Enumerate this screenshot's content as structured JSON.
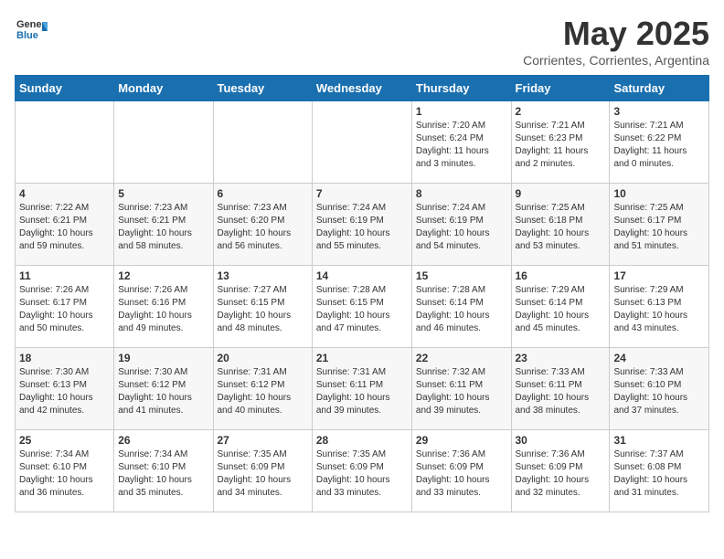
{
  "logo": {
    "general": "General",
    "blue": "Blue"
  },
  "title": "May 2025",
  "subtitle": "Corrientes, Corrientes, Argentina",
  "headers": [
    "Sunday",
    "Monday",
    "Tuesday",
    "Wednesday",
    "Thursday",
    "Friday",
    "Saturday"
  ],
  "weeks": [
    [
      {
        "day": "",
        "info": ""
      },
      {
        "day": "",
        "info": ""
      },
      {
        "day": "",
        "info": ""
      },
      {
        "day": "",
        "info": ""
      },
      {
        "day": "1",
        "info": "Sunrise: 7:20 AM\nSunset: 6:24 PM\nDaylight: 11 hours\nand 3 minutes."
      },
      {
        "day": "2",
        "info": "Sunrise: 7:21 AM\nSunset: 6:23 PM\nDaylight: 11 hours\nand 2 minutes."
      },
      {
        "day": "3",
        "info": "Sunrise: 7:21 AM\nSunset: 6:22 PM\nDaylight: 11 hours\nand 0 minutes."
      }
    ],
    [
      {
        "day": "4",
        "info": "Sunrise: 7:22 AM\nSunset: 6:21 PM\nDaylight: 10 hours\nand 59 minutes."
      },
      {
        "day": "5",
        "info": "Sunrise: 7:23 AM\nSunset: 6:21 PM\nDaylight: 10 hours\nand 58 minutes."
      },
      {
        "day": "6",
        "info": "Sunrise: 7:23 AM\nSunset: 6:20 PM\nDaylight: 10 hours\nand 56 minutes."
      },
      {
        "day": "7",
        "info": "Sunrise: 7:24 AM\nSunset: 6:19 PM\nDaylight: 10 hours\nand 55 minutes."
      },
      {
        "day": "8",
        "info": "Sunrise: 7:24 AM\nSunset: 6:19 PM\nDaylight: 10 hours\nand 54 minutes."
      },
      {
        "day": "9",
        "info": "Sunrise: 7:25 AM\nSunset: 6:18 PM\nDaylight: 10 hours\nand 53 minutes."
      },
      {
        "day": "10",
        "info": "Sunrise: 7:25 AM\nSunset: 6:17 PM\nDaylight: 10 hours\nand 51 minutes."
      }
    ],
    [
      {
        "day": "11",
        "info": "Sunrise: 7:26 AM\nSunset: 6:17 PM\nDaylight: 10 hours\nand 50 minutes."
      },
      {
        "day": "12",
        "info": "Sunrise: 7:26 AM\nSunset: 6:16 PM\nDaylight: 10 hours\nand 49 minutes."
      },
      {
        "day": "13",
        "info": "Sunrise: 7:27 AM\nSunset: 6:15 PM\nDaylight: 10 hours\nand 48 minutes."
      },
      {
        "day": "14",
        "info": "Sunrise: 7:28 AM\nSunset: 6:15 PM\nDaylight: 10 hours\nand 47 minutes."
      },
      {
        "day": "15",
        "info": "Sunrise: 7:28 AM\nSunset: 6:14 PM\nDaylight: 10 hours\nand 46 minutes."
      },
      {
        "day": "16",
        "info": "Sunrise: 7:29 AM\nSunset: 6:14 PM\nDaylight: 10 hours\nand 45 minutes."
      },
      {
        "day": "17",
        "info": "Sunrise: 7:29 AM\nSunset: 6:13 PM\nDaylight: 10 hours\nand 43 minutes."
      }
    ],
    [
      {
        "day": "18",
        "info": "Sunrise: 7:30 AM\nSunset: 6:13 PM\nDaylight: 10 hours\nand 42 minutes."
      },
      {
        "day": "19",
        "info": "Sunrise: 7:30 AM\nSunset: 6:12 PM\nDaylight: 10 hours\nand 41 minutes."
      },
      {
        "day": "20",
        "info": "Sunrise: 7:31 AM\nSunset: 6:12 PM\nDaylight: 10 hours\nand 40 minutes."
      },
      {
        "day": "21",
        "info": "Sunrise: 7:31 AM\nSunset: 6:11 PM\nDaylight: 10 hours\nand 39 minutes."
      },
      {
        "day": "22",
        "info": "Sunrise: 7:32 AM\nSunset: 6:11 PM\nDaylight: 10 hours\nand 39 minutes."
      },
      {
        "day": "23",
        "info": "Sunrise: 7:33 AM\nSunset: 6:11 PM\nDaylight: 10 hours\nand 38 minutes."
      },
      {
        "day": "24",
        "info": "Sunrise: 7:33 AM\nSunset: 6:10 PM\nDaylight: 10 hours\nand 37 minutes."
      }
    ],
    [
      {
        "day": "25",
        "info": "Sunrise: 7:34 AM\nSunset: 6:10 PM\nDaylight: 10 hours\nand 36 minutes."
      },
      {
        "day": "26",
        "info": "Sunrise: 7:34 AM\nSunset: 6:10 PM\nDaylight: 10 hours\nand 35 minutes."
      },
      {
        "day": "27",
        "info": "Sunrise: 7:35 AM\nSunset: 6:09 PM\nDaylight: 10 hours\nand 34 minutes."
      },
      {
        "day": "28",
        "info": "Sunrise: 7:35 AM\nSunset: 6:09 PM\nDaylight: 10 hours\nand 33 minutes."
      },
      {
        "day": "29",
        "info": "Sunrise: 7:36 AM\nSunset: 6:09 PM\nDaylight: 10 hours\nand 33 minutes."
      },
      {
        "day": "30",
        "info": "Sunrise: 7:36 AM\nSunset: 6:09 PM\nDaylight: 10 hours\nand 32 minutes."
      },
      {
        "day": "31",
        "info": "Sunrise: 7:37 AM\nSunset: 6:08 PM\nDaylight: 10 hours\nand 31 minutes."
      }
    ]
  ]
}
